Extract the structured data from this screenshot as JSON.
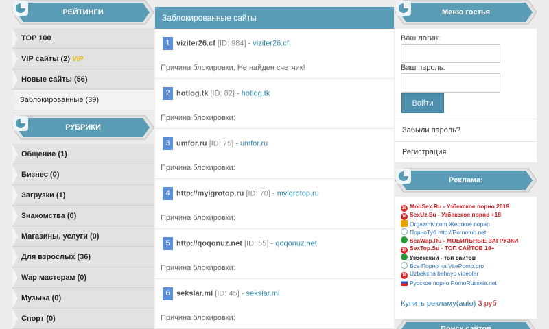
{
  "colors": {
    "banner": "#5a9bb5",
    "banner_border": "#7aa6bc",
    "center_header": "#5a9bb5",
    "link": "#2f8ab0",
    "badge": "#5d8fd9",
    "ad_red": "#c41d1d"
  },
  "left": {
    "ratings_title": "РЕЙТИНГИ",
    "ratings": [
      {
        "label": "TOP 100"
      },
      {
        "label": "VIP сайты (2)",
        "badge": "VIP"
      },
      {
        "label": "Новые сайты (56)"
      },
      {
        "label": "Заблокированные (39)"
      }
    ],
    "rubrics_title": "РУБРИКИ",
    "rubrics": [
      {
        "label": "Общение (1)"
      },
      {
        "label": "Бизнес (0)"
      },
      {
        "label": "Загрузки (1)"
      },
      {
        "label": "Знакомства (0)"
      },
      {
        "label": "Магазины, услуги (0)"
      },
      {
        "label": "Для взрослых (36)"
      },
      {
        "label": "Wap мастерам (0)"
      },
      {
        "label": "Музыка (0)"
      },
      {
        "label": "Спорт (0)"
      }
    ]
  },
  "center": {
    "title": "Заблокированные сайты",
    "sites": [
      {
        "num": "1",
        "name": "viziter26.cf",
        "id": "[ID: 984] -",
        "link": "viziter26.cf",
        "reason": "Причина блокировки: Не найден счетчик!"
      },
      {
        "num": "2",
        "name": "hotlog.tk",
        "id": "[ID: 82] -",
        "link": "hotlog.tk",
        "reason": "Причина блокировки:"
      },
      {
        "num": "3",
        "name": "umfor.ru",
        "id": "[ID: 75] -",
        "link": "umfor.ru",
        "reason": "Причина блокировки:"
      },
      {
        "num": "4",
        "name": "http://myigrotop.ru",
        "id": "[ID: 70] -",
        "link": "myigrotop.ru",
        "reason": "Причина блокировки:"
      },
      {
        "num": "5",
        "name": "http://qoqonuz.net",
        "id": "[ID: 55] -",
        "link": "qoqonuz.net",
        "reason": "Причина блокировки:"
      },
      {
        "num": "6",
        "name": "sekslar.ml",
        "id": "[ID: 45] -",
        "link": "sekslar.ml",
        "reason": "Причина блокировки:"
      }
    ]
  },
  "right": {
    "guest_title": "Меню гостья",
    "login_label": "Ваш логин:",
    "password_label": "Ваш пароль:",
    "login_button": "Войти",
    "forgot": "Забыли пароль?",
    "register": "Регистрация",
    "ads_title": "Реклама:",
    "ads": [
      {
        "text": "MobSex.Ru - Узбекское порно 2019",
        "style": "red",
        "icon": "+18"
      },
      {
        "text": "SexUz.Su - Узбекское порно +18",
        "style": "red",
        "icon": "+18"
      },
      {
        "text": "Orgazmtv.com Жесткое порно",
        "style": "blue",
        "icon": "sq"
      },
      {
        "text": "ПорноТуб http://Pornotub.net",
        "style": "blue",
        "icon": "globe"
      },
      {
        "text": "SeaWap.Ru - МОБИЛЬНЫЕ ЗАГРУЗКИ",
        "style": "red",
        "icon": "green"
      },
      {
        "text": "SexTop.Su - ТОП САЙТОВ 18+",
        "style": "red",
        "icon": "+18"
      },
      {
        "text": "Узбекский - топ сайтов",
        "style": "black",
        "icon": "green"
      },
      {
        "text": "Все Порно на VsePorno.pro",
        "style": "blue",
        "icon": "globe"
      },
      {
        "text": "Uzbekcha behayo videolar",
        "style": "blue",
        "icon": "+18"
      },
      {
        "text": "Русское порно PornoRusskie.net",
        "style": "blue",
        "icon": "flag"
      }
    ],
    "buy_ad": "Купить рекламу(auto)",
    "buy_price": "3 руб",
    "bottom_title": "Поиск сайтов"
  }
}
